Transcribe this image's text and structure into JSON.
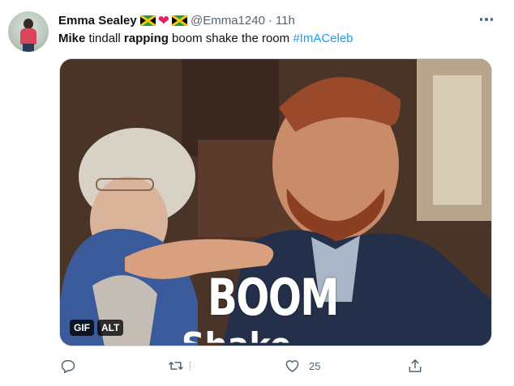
{
  "tweet": {
    "author_name": "Emma Sealey",
    "emoji_after_name": [
      "jamaica-flag",
      "red-heart",
      "jamaica-flag"
    ],
    "handle": "@Emma1240",
    "separator": "·",
    "time": "11h",
    "text": {
      "part1_bold": "Mike",
      "part2": " tindall ",
      "part3_bold": "rapping",
      "part4": " boom shake the room ",
      "hashtag": "#ImACeleb"
    },
    "media": {
      "caption": "BOOM",
      "caption_partial": "Shake",
      "gif_badge": "GIF",
      "alt_badge": "ALT"
    },
    "actions": {
      "reply_icon": "reply-icon",
      "retweet_icon": "retweet-icon",
      "like_icon": "heart-icon",
      "like_count": "25",
      "share_icon": "share-icon"
    }
  },
  "colors": {
    "accent": "#1d9bf0",
    "text_primary": "#0f1419",
    "text_secondary": "#536471",
    "heart": "#e0245e"
  }
}
